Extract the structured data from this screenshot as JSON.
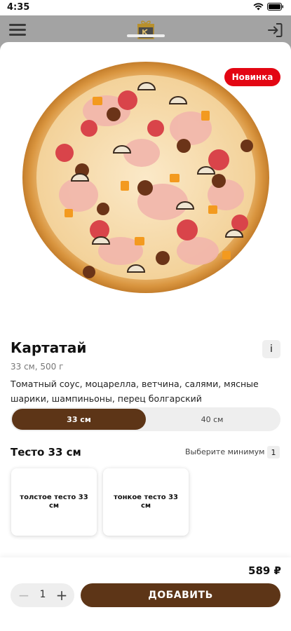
{
  "status_bar": {
    "time": "4:35"
  },
  "header": {
    "menu_icon": "hamburger-menu-icon",
    "logo_icon": "gift-box-logo-icon",
    "login_icon": "sign-in-icon"
  },
  "product": {
    "badge": "Новинка",
    "name": "Картатай",
    "size_weight": "33 см, 500 г",
    "description": "Томатный соус, моцарелла, ветчина, салями, мясные шарики, шампиньоны, перец болгарский",
    "info_label": "i"
  },
  "size_options": [
    {
      "label": "33 см",
      "selected": true
    },
    {
      "label": "40 см",
      "selected": false
    }
  ],
  "dough_section": {
    "title": "Тесто 33 см",
    "min_label": "Выберите минимум",
    "min_count": "1",
    "options": [
      {
        "label": "толстое тесто 33 см"
      },
      {
        "label": "тонкое тесто 33 см"
      }
    ]
  },
  "footer": {
    "price": "589 ₽",
    "quantity": "1",
    "minus": "−",
    "plus": "+",
    "add_label": "ДОБАВИТЬ"
  },
  "colors": {
    "brand_brown": "#5d3517",
    "badge_red": "#e30613",
    "header_gray": "#a3a3a3"
  }
}
